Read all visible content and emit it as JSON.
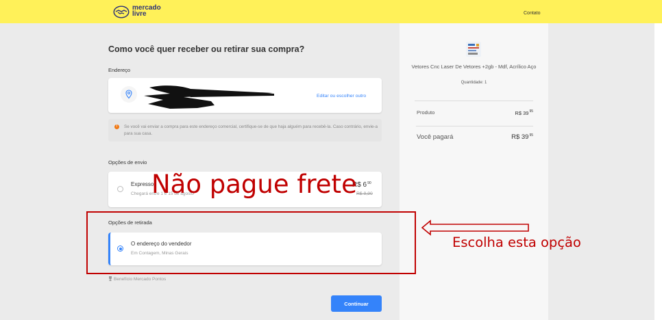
{
  "header": {
    "logo_line1": "mercado",
    "logo_line2": "livre",
    "contact_link": "Contato",
    "bar_color": "#fff159"
  },
  "checkout": {
    "title": "Como você quer receber ou retirar sua compra?",
    "address_section_label": "Endereço",
    "edit_address_link": "Editar ou escolher outro",
    "notice_text": "Se você vai enviar a compra para este endereço comercial, certifique-se de que haja alguém para recebê-la. Caso contrário, envie-a para sua casa.",
    "shipping_section_label": "Opções de envio",
    "shipping_option": {
      "title": "Expresso",
      "subtitle": "Chegará entre 1 e 15 de agosto",
      "price_int": "R$ 6",
      "price_cents": "90",
      "price_old": "R$ 9,90",
      "selected": false
    },
    "pickup_section_label": "Opções de retirada",
    "pickup_option": {
      "title": "O endereço do vendedor",
      "subtitle": "Em Contagem, Minas Gerais",
      "selected": true
    },
    "benefit_text": "Benefício Mercado Pontos",
    "continue_button": "Continuar",
    "accent_color": "#3483fa"
  },
  "summary": {
    "product_title": "Vetores Cnc Laser De Vetores +2gb - Mdf, Acrílico Aço",
    "quantity_text": "Quantidade: 1",
    "product_label": "Produto",
    "product_price_int": "R$ 39",
    "product_price_cents": "95",
    "total_label": "Você pagará",
    "total_price_int": "R$ 39",
    "total_price_cents": "95"
  },
  "annotations": {
    "headline": "Não pague frete",
    "callout": "Escolha esta opção",
    "color": "#c00000"
  }
}
